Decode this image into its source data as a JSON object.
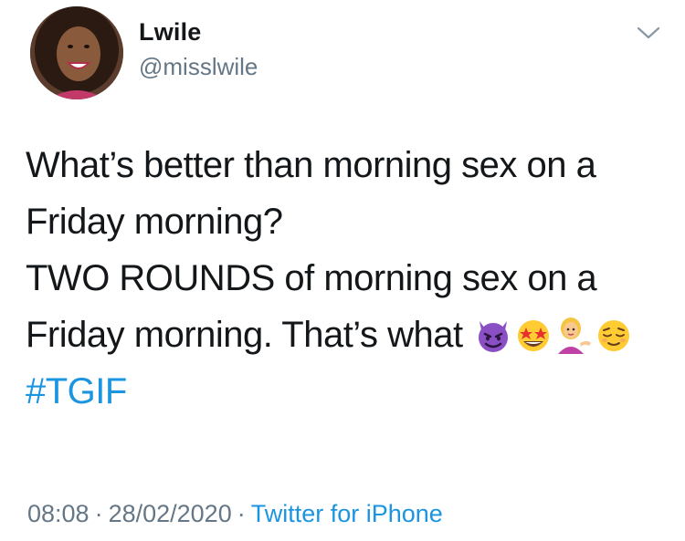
{
  "tweet": {
    "author_name": "Lwile",
    "author_handle": "@misslwile",
    "avatar": "profile-photo",
    "text_lines": [
      "What’s better than morning sex on a",
      "Friday morning?",
      "TWO ROUNDS of morning sex on a",
      "Friday morning. That’s what"
    ],
    "emojis": [
      "smiling-devil-emoji",
      "star-struck-emoji",
      "woman-tipping-hand-emoji",
      "relieved-face-emoji"
    ],
    "hashtag": "#TGIF",
    "time": "08:08",
    "date": "28/02/2020",
    "separator": "·",
    "source": "Twitter for iPhone",
    "menu_icon": "chevron-down-icon"
  },
  "colors": {
    "text": "#14171a",
    "secondary": "#657786",
    "link": "#1b95e0",
    "background": "#ffffff"
  }
}
